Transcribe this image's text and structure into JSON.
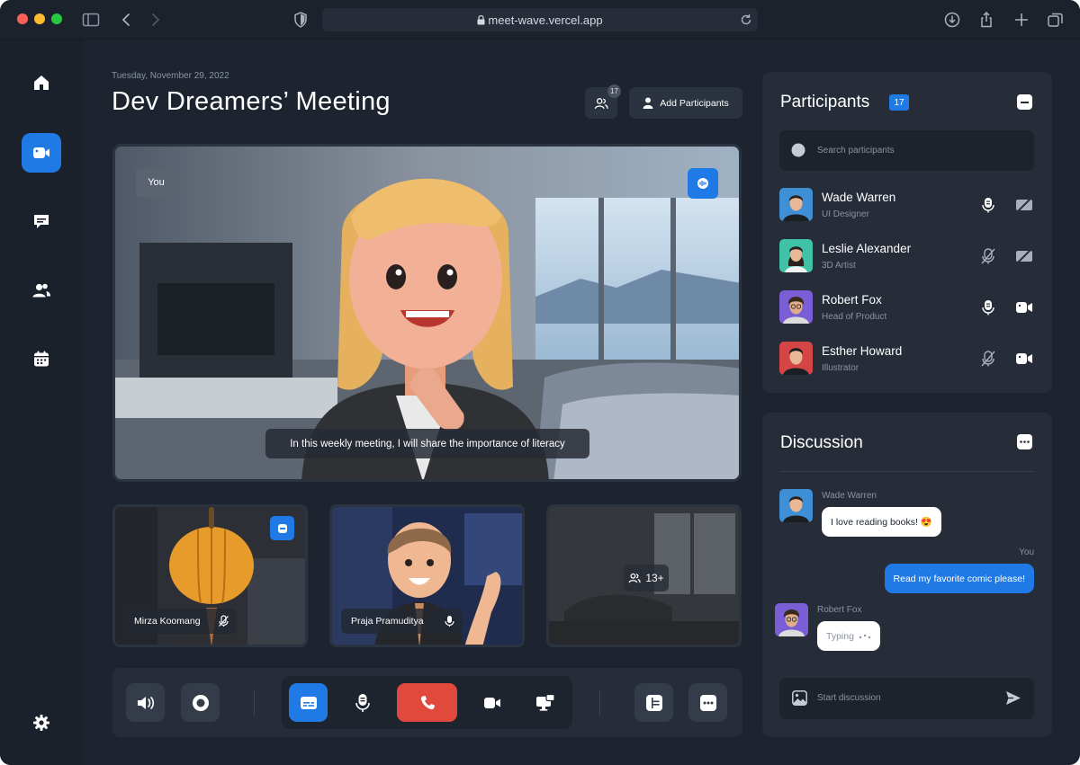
{
  "browser": {
    "url": "meet-wave.vercel.app"
  },
  "meeting": {
    "date": "Tuesday, November 29, 2022",
    "title": "Dev Dreamers’ Meeting",
    "participant_count": "17",
    "add_label": "Add Participants"
  },
  "main_video": {
    "you_label": "You",
    "caption": "In this weekly meeting, I will share the importance of literacy"
  },
  "tiles": [
    {
      "name": "Mirza Koomang"
    },
    {
      "name": "Praja Pramuditya"
    },
    {
      "more_count": "13+"
    }
  ],
  "participants_panel": {
    "title": "Participants",
    "count": "17",
    "search_placeholder": "Search participants",
    "people": [
      {
        "name": "Wade Warren",
        "role": "UI Designer",
        "mic": "on",
        "cam": "off",
        "color": "#3f8fd6"
      },
      {
        "name": "Leslie Alexander",
        "role": "3D Artist",
        "mic": "off",
        "cam": "off",
        "color": "#3fc2a8"
      },
      {
        "name": "Robert Fox",
        "role": "Head of Product",
        "mic": "on",
        "cam": "on",
        "color": "#7a5ed6"
      },
      {
        "name": "Esther Howard",
        "role": "Illustrator",
        "mic": "off",
        "cam": "on",
        "color": "#d64545"
      }
    ]
  },
  "discussion": {
    "title": "Discussion",
    "messages": [
      {
        "sender": "Wade Warren",
        "text": "I love reading books! 😍"
      },
      {
        "sender": "You",
        "text": "Read my favorite comic please!"
      },
      {
        "sender": "Robert Fox",
        "text": "Typing"
      }
    ],
    "input_placeholder": "Start discussion"
  },
  "colors": {
    "accent": "#1f7ae6",
    "danger": "#e0493c",
    "panel": "#262d38",
    "background": "#1d2430"
  }
}
